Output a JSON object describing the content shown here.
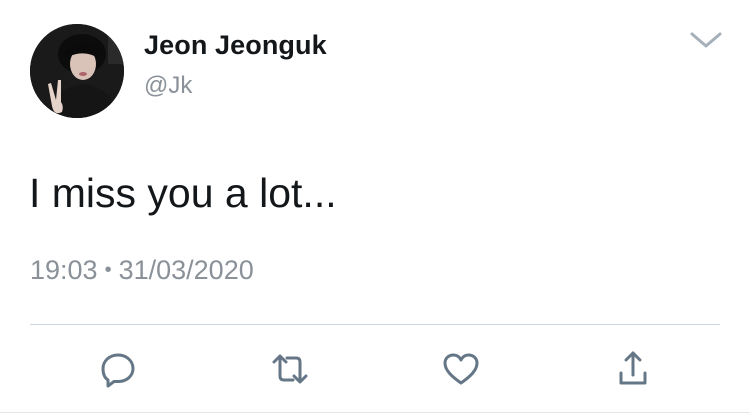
{
  "tweet": {
    "author": {
      "display_name": "Jeon Jeonguk",
      "handle": "@Jk"
    },
    "text": "I miss you a lot...",
    "time": "19:03",
    "separator": "•",
    "date": "31/03/2020"
  },
  "actions": {
    "icons": [
      "reply-icon",
      "retweet-icon",
      "like-icon",
      "share-icon"
    ]
  },
  "colors": {
    "icon": "#657786",
    "secondary_text": "#8a9199",
    "primary_text": "#14171a",
    "divider": "#cfd6dc"
  }
}
